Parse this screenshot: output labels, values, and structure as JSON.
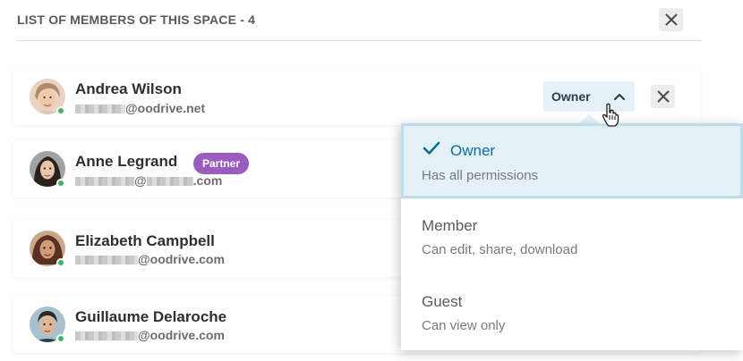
{
  "header": {
    "title": "LIST OF MEMBERS OF THIS SPACE  - 4",
    "close_icon": "close-icon"
  },
  "members": [
    {
      "name": "Andrea Wilson",
      "email_domain": "@oodrive.net",
      "status": "online"
    },
    {
      "name": "Anne Legrand",
      "badge": "Partner",
      "email_domain": "@",
      "email_tld": ".com",
      "status": "online"
    },
    {
      "name": "Elizabeth Campbell",
      "email_domain": "@oodrive.com",
      "status": "online"
    },
    {
      "name": "Guillaume Delaroche",
      "email_domain": "@oodrive.com",
      "status": "online"
    }
  ],
  "role_selector": {
    "current": "Owner",
    "state": "open"
  },
  "role_options": [
    {
      "title": "Owner",
      "description": "Has all permissions",
      "selected": true
    },
    {
      "title": "Member",
      "description": "Can edit, share, download",
      "selected": false
    },
    {
      "title": "Guest",
      "description": "Can view only",
      "selected": false
    }
  ],
  "colors": {
    "accent": "#0c6f98",
    "selected_bg": "#e3f1f7",
    "partner_badge": "#9a5cbf",
    "online": "#3fb56a"
  }
}
